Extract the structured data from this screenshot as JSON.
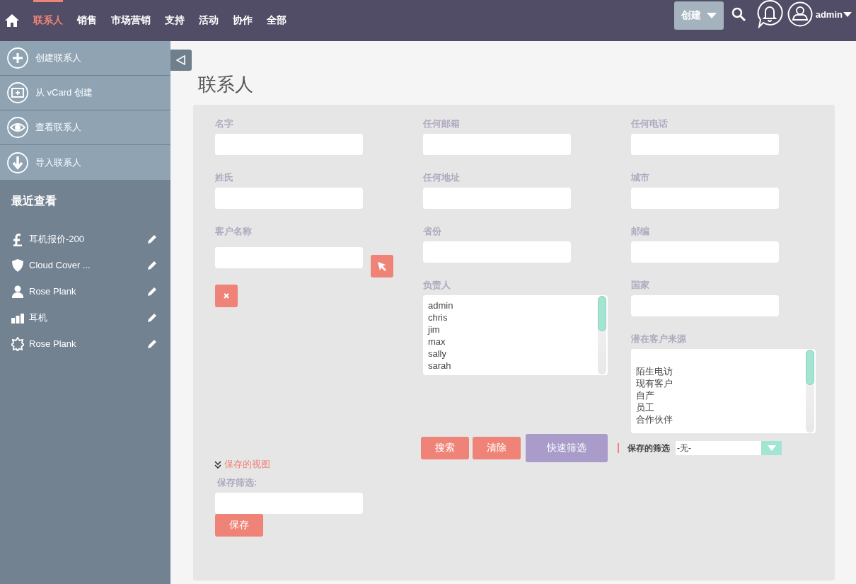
{
  "nav": {
    "tabs": [
      {
        "label": "联系人",
        "selected": true
      },
      {
        "label": "销售",
        "selected": false
      },
      {
        "label": "市场营销",
        "selected": false
      },
      {
        "label": "支持",
        "selected": false
      },
      {
        "label": "活动",
        "selected": false
      },
      {
        "label": "协作",
        "selected": false
      },
      {
        "label": "全部",
        "selected": false
      }
    ],
    "create_button": "创建",
    "user": "admin"
  },
  "sidebar": {
    "actions": [
      {
        "label": "创建联系人",
        "kind": "plus"
      },
      {
        "label": "从 vCard 创建",
        "kind": "card"
      },
      {
        "label": "查看联系人",
        "kind": "eye"
      },
      {
        "label": "导入联系人",
        "kind": "download"
      }
    ],
    "recent_title": "最近查看",
    "recent": [
      {
        "label": "耳机报价-200",
        "kind": "pound"
      },
      {
        "label": "Cloud Cover ...",
        "kind": "shield"
      },
      {
        "label": "Rose Plank",
        "kind": "person"
      },
      {
        "label": "耳机",
        "kind": "bars"
      },
      {
        "label": "Rose Plank",
        "kind": "badge"
      }
    ]
  },
  "page_title": "联系人",
  "filter": {
    "columns": [
      [
        {
          "label": "名字",
          "kind": "text"
        },
        {
          "label": "姓氏",
          "kind": "text"
        },
        {
          "label": "客户名称",
          "kind": "relate"
        }
      ],
      [
        {
          "label": "任何邮箱",
          "kind": "text"
        },
        {
          "label": "任何地址",
          "kind": "text"
        },
        {
          "label": "省份",
          "kind": "text"
        },
        {
          "label": "负责人",
          "kind": "multiselect",
          "options": [
            "admin",
            "chris",
            "jim",
            "max",
            "sally",
            "sarah"
          ]
        }
      ],
      [
        {
          "label": "任何电话",
          "kind": "text"
        },
        {
          "label": "城市",
          "kind": "text"
        },
        {
          "label": "邮编",
          "kind": "text"
        },
        {
          "label": "国家",
          "kind": "text"
        },
        {
          "label": "潜在客户来源",
          "kind": "multiselect",
          "blank_first": true,
          "options": [
            "陌生电访",
            "现有客户",
            "自产",
            "员工",
            "合作伙伴"
          ]
        }
      ]
    ],
    "buttons": [
      {
        "label": "搜索",
        "kind": "action"
      },
      {
        "label": "清除",
        "kind": "action"
      },
      {
        "label": "快速筛选",
        "kind": "quick"
      }
    ],
    "saved_filter": {
      "label": "保存的筛选",
      "value": "-无-"
    },
    "saved_views": {
      "toggle": "保存的视图",
      "field_label": "保存筛选:",
      "save_button": "保存"
    }
  }
}
